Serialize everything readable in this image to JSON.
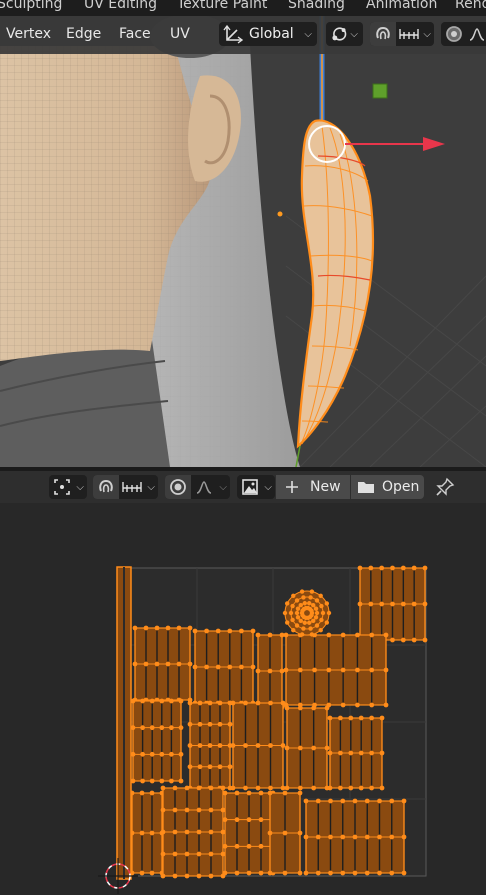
{
  "workspace_tabs": [
    "Sculpting",
    "UV Editing",
    "Texture Paint",
    "Shading",
    "Animation",
    "Rend"
  ],
  "viewport_header": {
    "menus": [
      "Vertex",
      "Edge",
      "Face",
      "UV"
    ],
    "orientation_label": "Global"
  },
  "uv_header": {
    "new_label": "New",
    "open_label": "Open"
  },
  "colors": {
    "selection": "#ff8c1a",
    "gizmo_x": "#e8364b",
    "gizmo_z": "#3b7dd8",
    "gizmo_y": "#5fa02b",
    "background": "#282828"
  },
  "icons": [
    "transform-orientation-icon",
    "pivot-icon",
    "snap-icon",
    "snap-increment-icon",
    "proportional-edit-icon",
    "falloff-icon",
    "select-mode-icon",
    "image-icon",
    "plus-icon",
    "folder-icon",
    "pin-icon"
  ]
}
